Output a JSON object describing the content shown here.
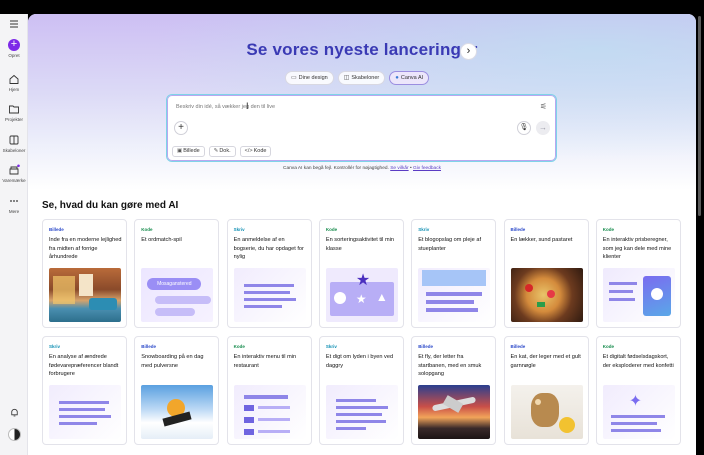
{
  "sidebar": {
    "create_label": "Opret",
    "items": [
      {
        "label": "Hjem",
        "icon": "home-icon"
      },
      {
        "label": "Projekter",
        "icon": "folder-icon"
      },
      {
        "label": "Skabeloner",
        "icon": "templates-icon"
      },
      {
        "label": "Varemærke",
        "icon": "brand-icon"
      },
      {
        "label": "Mere",
        "icon": "more-icon"
      }
    ]
  },
  "hero": {
    "title": "Se vores nyeste lanceringer",
    "tabs": [
      {
        "label": "Dine design",
        "active": false
      },
      {
        "label": "Skabeloner",
        "active": false
      },
      {
        "label": "Canva AI",
        "active": true
      }
    ],
    "prompt": {
      "placeholder": "Beskriv din idé, så vækker jeg den til live",
      "pills": [
        "Billede",
        "Dok.",
        "Kode"
      ]
    },
    "disclaimer_text": "Canva AI kan begå fejl. Kontrollér for nøjagtighed.",
    "disclaimer_link1": "Se vilkår",
    "disclaimer_sep": "•",
    "disclaimer_link2": "Giv feedback"
  },
  "section": {
    "title": "Se, hvad du kan gøre med AI",
    "cards": [
      {
        "tag": "Billede",
        "kind": "img",
        "title": "Inde fra en moderne lejlighed fra midten af forrige århundrede",
        "thumb": "room"
      },
      {
        "tag": "Kode",
        "kind": "code",
        "title": "Et ordmatch-spil",
        "thumb": "word",
        "thumb_text": "Mosaganstered"
      },
      {
        "tag": "Skriv",
        "kind": "write",
        "title": "En anmeldelse af en bogserie, du har opdaget for nylig",
        "thumb": "lines"
      },
      {
        "tag": "Kode",
        "kind": "code",
        "title": "En sorteringsaktivitet til min klasse",
        "thumb": "shapes"
      },
      {
        "tag": "Skriv",
        "kind": "write",
        "title": "Et blogopslag om pleje af stueplanter",
        "thumb": "blog"
      },
      {
        "tag": "Billede",
        "kind": "img",
        "title": "En lækker, sund pastaret",
        "thumb": "pasta"
      },
      {
        "tag": "Kode",
        "kind": "code",
        "title": "En interaktiv prisberegner, som jeg kan dele med mine klienter",
        "thumb": "calc"
      },
      {
        "tag": "Skriv",
        "kind": "write",
        "title": "En analyse af ændrede fødevarepræferencer blandt forbrugere",
        "thumb": "lines"
      },
      {
        "tag": "Billede",
        "kind": "img",
        "title": "Snowboarding på en dag med pulversne",
        "thumb": "snow"
      },
      {
        "tag": "Kode",
        "kind": "code",
        "title": "En interaktiv menu til min restaurant",
        "thumb": "menu"
      },
      {
        "tag": "Skriv",
        "kind": "write",
        "title": "Et digt om lyden i byen ved daggry",
        "thumb": "lines2"
      },
      {
        "tag": "Billede",
        "kind": "img",
        "title": "Et fly, der letter fra startbanen, med en smuk solopgang",
        "thumb": "plane"
      },
      {
        "tag": "Billede",
        "kind": "img",
        "title": "En kat, der leger med et gult garnnøgle",
        "thumb": "cat"
      },
      {
        "tag": "Kode",
        "kind": "code",
        "title": "Et digitalt fødselsdagskort, der eksploderer med konfetti",
        "thumb": "confetti"
      }
    ]
  }
}
